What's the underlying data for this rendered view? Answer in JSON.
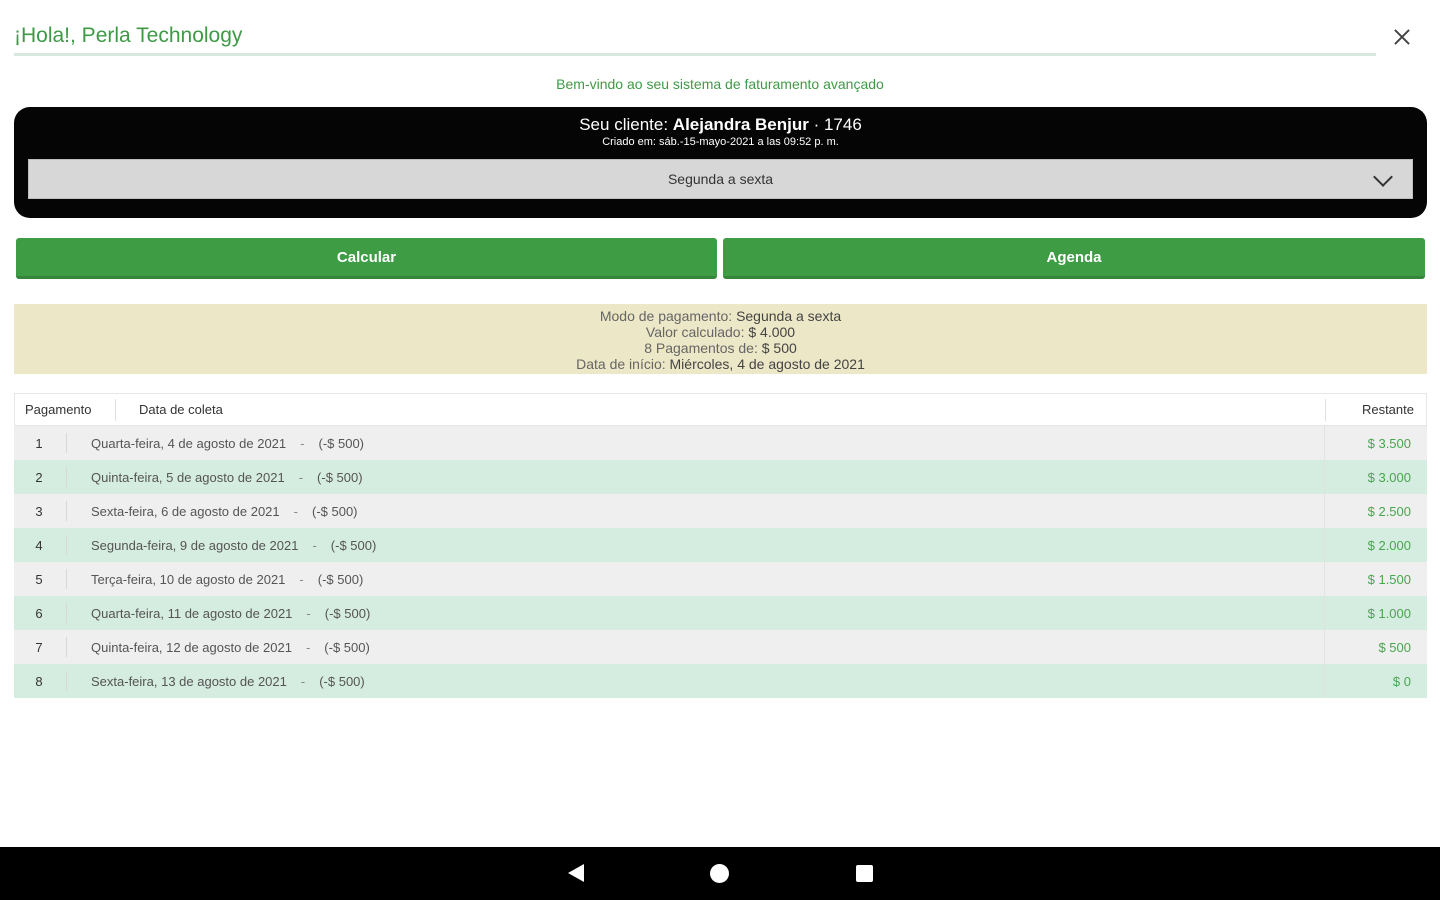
{
  "header": {
    "greeting": "¡Hola!, Perla Technology",
    "close_icon": "close-icon"
  },
  "welcome": "Bem-vindo ao seu sistema de faturamento avançado",
  "client": {
    "label": "Seu cliente:",
    "name": "Alejandra Benjur",
    "id": "· 1746",
    "created": "Criado em: sáb.-15-mayo-2021 a las 09:52 p. m.",
    "frequency": "Segunda a sexta"
  },
  "buttons": {
    "calculate": "Calcular",
    "schedule": "Agenda"
  },
  "summary": {
    "mode_label": "Modo de pagamento:",
    "mode_value": "Segunda a sexta",
    "calc_label": "Valor calculado:",
    "calc_value": "$ 4.000",
    "payments_label": "8 Pagamentos de:",
    "payments_value": "$ 500",
    "start_label": "Data de início:",
    "start_value": "Miércoles, 4 de agosto de 2021"
  },
  "table": {
    "headers": [
      "Pagamento",
      "Data de coleta",
      "Restante"
    ],
    "rows": [
      {
        "num": "1",
        "date": "Quarta-feira, 4 de agosto de 2021",
        "amount": "(-$ 500)",
        "remaining": "$ 3.500"
      },
      {
        "num": "2",
        "date": "Quinta-feira, 5 de agosto de 2021",
        "amount": "(-$ 500)",
        "remaining": "$ 3.000"
      },
      {
        "num": "3",
        "date": "Sexta-feira, 6 de agosto de 2021",
        "amount": "(-$ 500)",
        "remaining": "$ 2.500"
      },
      {
        "num": "4",
        "date": "Segunda-feira, 9 de agosto de 2021",
        "amount": "(-$ 500)",
        "remaining": "$ 2.000"
      },
      {
        "num": "5",
        "date": "Terça-feira, 10 de agosto de 2021",
        "amount": "(-$ 500)",
        "remaining": "$ 1.500"
      },
      {
        "num": "6",
        "date": "Quarta-feira, 11 de agosto de 2021",
        "amount": "(-$ 500)",
        "remaining": "$ 1.000"
      },
      {
        "num": "7",
        "date": "Quinta-feira, 12 de agosto de 2021",
        "amount": "(-$ 500)",
        "remaining": "$ 500"
      },
      {
        "num": "8",
        "date": "Sexta-feira, 13 de agosto de 2021",
        "amount": "(-$ 500)",
        "remaining": "$ 0"
      }
    ]
  },
  "colors": {
    "accent": "#3e9c45",
    "row_even": "#d5ece0",
    "row_odd": "#efefef",
    "summary_bg": "#ebe7c7",
    "panel_bg": "#050505"
  },
  "navbar": {
    "icons": [
      "back-icon",
      "home-icon",
      "recents-icon"
    ]
  }
}
